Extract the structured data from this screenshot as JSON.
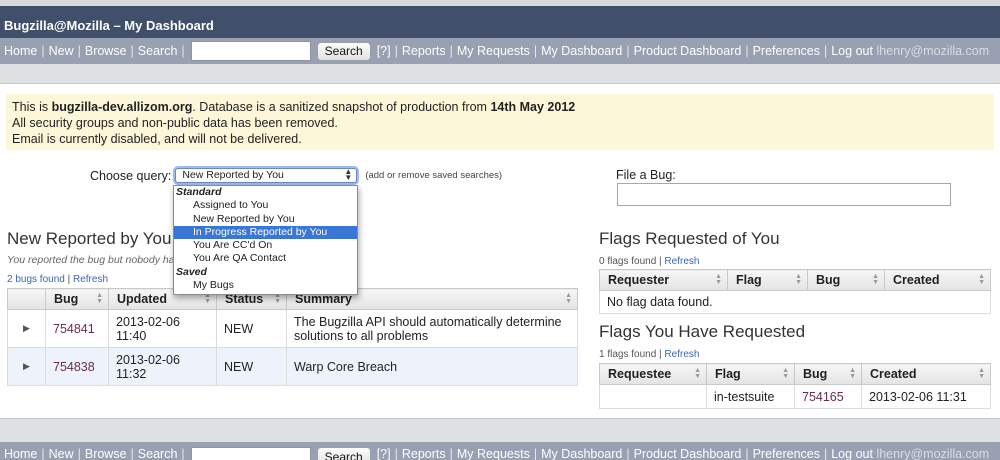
{
  "title": "Bugzilla@Mozilla – My Dashboard",
  "nav": {
    "home": "Home",
    "new": "New",
    "browse": "Browse",
    "search": "Search",
    "search_button": "Search",
    "help": "[?]",
    "reports": "Reports",
    "my_requests": "My Requests",
    "my_dashboard": "My Dashboard",
    "product_dashboard": "Product Dashboard",
    "preferences": "Preferences",
    "logout": "Log out",
    "user": "lhenry@mozilla.com"
  },
  "notice": {
    "line1_pre": "This is ",
    "line1_host": "bugzilla-dev.allizom.org",
    "line1_mid": ". Database is a sanitized snapshot of production from ",
    "line1_date": "14th May 2012",
    "line2": "All security groups and non-public data has been removed.",
    "line3": "Email is currently disabled, and will not be delivered."
  },
  "query": {
    "label": "Choose query:",
    "selected": "New Reported by You",
    "hint": "(add or remove saved searches)",
    "dropdown": {
      "group_standard": "Standard",
      "opt1": "Assigned to You",
      "opt2": "New Reported by You",
      "opt3": "In Progress Reported by You",
      "opt4": "You Are CC'd On",
      "opt5": "You Are QA Contact",
      "group_saved": "Saved",
      "opt6": "My Bugs"
    }
  },
  "file_bug": {
    "label": "File a Bug:"
  },
  "bugs_panel": {
    "heading": "New Reported by You",
    "note": "You reported the bug but nobody has accepted it yet.",
    "count": "2 bugs found",
    "refresh": "Refresh",
    "columns": {
      "bug": "Bug",
      "updated": "Updated",
      "status": "Status",
      "summary": "Summary"
    },
    "rows": [
      {
        "bug": "754841",
        "updated": "2013-02-06 11:40",
        "status": "NEW",
        "summary": "The Bugzilla API should automatically determine solutions to all problems"
      },
      {
        "bug": "754838",
        "updated": "2013-02-06 11:32",
        "status": "NEW",
        "summary": "Warp Core Breach"
      }
    ]
  },
  "flags_requested_of_you": {
    "heading": "Flags Requested of You",
    "count": "0 flags found",
    "refresh": "Refresh",
    "columns": {
      "requester": "Requester",
      "flag": "Flag",
      "bug": "Bug",
      "created": "Created"
    },
    "empty": "No flag data found."
  },
  "flags_you_requested": {
    "heading": "Flags You Have Requested",
    "count": "1 flags found",
    "refresh": "Refresh",
    "columns": {
      "requestee": "Requestee",
      "flag": "Flag",
      "bug": "Bug",
      "created": "Created"
    },
    "rows": [
      {
        "requestee": "",
        "flag": "in-testsuite",
        "bug": "754165",
        "created": "2013-02-06 11:31"
      }
    ]
  },
  "colors": {
    "titlebar": "#404f6a",
    "navbar": "#98a0b2",
    "notice": "#fdf7d9",
    "selection": "#3a76d6",
    "link": "#6b2c52"
  }
}
